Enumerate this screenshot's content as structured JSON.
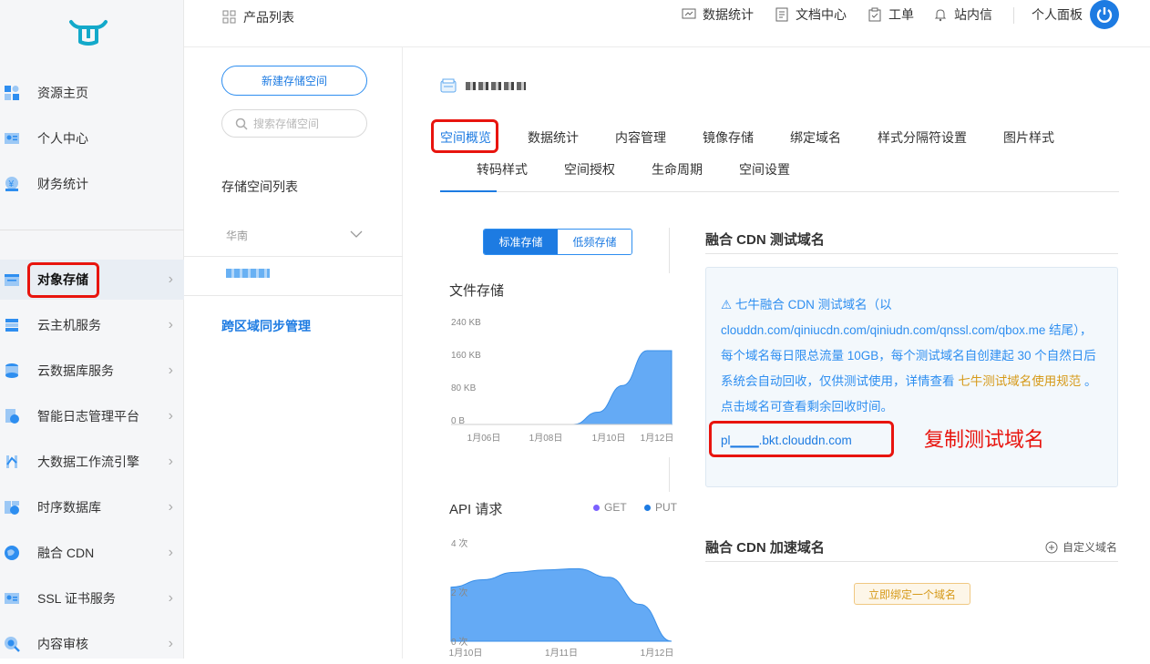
{
  "sidebar": {
    "items": [
      {
        "label": "资源主页",
        "icon": "resource-home-icon"
      },
      {
        "label": "个人中心",
        "icon": "personal-center-icon"
      },
      {
        "label": "财务统计",
        "icon": "finance-icon"
      },
      {
        "label": "对象存储",
        "icon": "object-storage-icon"
      },
      {
        "label": "云主机服务",
        "icon": "cloud-host-icon"
      },
      {
        "label": "云数据库服务",
        "icon": "cloud-database-icon"
      },
      {
        "label": "智能日志管理平台",
        "icon": "log-platform-icon"
      },
      {
        "label": "大数据工作流引擎",
        "icon": "workflow-engine-icon"
      },
      {
        "label": "时序数据库",
        "icon": "timeseries-db-icon"
      },
      {
        "label": "融合 CDN",
        "icon": "cdn-icon"
      },
      {
        "label": "SSL 证书服务",
        "icon": "ssl-icon"
      },
      {
        "label": "内容审核",
        "icon": "content-review-icon"
      }
    ]
  },
  "header": {
    "product_list": "产品列表",
    "data_stats": "数据统计",
    "docs": "文档中心",
    "tickets": "工单",
    "inbox": "站内信",
    "personal_panel": "个人面板"
  },
  "bucket_panel": {
    "new_button": "新建存储空间",
    "search_placeholder": "搜索存储空间",
    "list_title": "存储空间列表",
    "region": "华南",
    "cross_region": "跨区域同步管理"
  },
  "tabs": [
    "空间概览",
    "数据统计",
    "内容管理",
    "镜像存储",
    "绑定域名",
    "样式分隔符设置",
    "图片样式",
    "转码样式",
    "空间授权",
    "生命周期",
    "空间设置"
  ],
  "storage_toggle": {
    "standard": "标准存储",
    "low_freq": "低频存储"
  },
  "file_storage": {
    "title": "文件存储",
    "chart_data": {
      "type": "area",
      "x_ticks": [
        "1月06日",
        "1月08日",
        "1月10日",
        "1月12日"
      ],
      "y_ticks": [
        "240 KB",
        "160 KB",
        "80 KB",
        "0 B"
      ],
      "ylim": [
        0,
        240
      ],
      "x": [
        0,
        1,
        2,
        3,
        4,
        5,
        6,
        7,
        8
      ],
      "values": [
        0,
        0,
        0,
        0,
        0,
        0,
        30,
        95,
        180,
        180
      ]
    }
  },
  "api_requests": {
    "title": "API 请求",
    "legend": [
      "GET",
      "PUT"
    ],
    "chart_data": {
      "type": "area",
      "x_ticks": [
        "1月10日",
        "1月11日",
        "1月12日"
      ],
      "y_ticks": [
        "4 次",
        "2 次",
        "0 次"
      ],
      "ylim": [
        0,
        4
      ],
      "series": [
        {
          "name": "PUT",
          "values": [
            2.2,
            2.5,
            2.8,
            2.9,
            2.95,
            2.6,
            1.5,
            0
          ]
        }
      ]
    }
  },
  "cdn_test": {
    "title": "融合 CDN 测试域名",
    "notice": "⚠ 七牛融合 CDN 测试域名（以 clouddn.com/qiniucdn.com/qiniudn.com/qnssl.com/qbox.me 结尾），每个域名每日限总流量 10GB，每个测试域名自创建起 30 个自然日后系统会自动回收，仅供测试使用，详情查看 ",
    "notice_link": "七牛测试域名使用规范",
    "notice_tail": " 。点击域名可查看剩余回收时间。",
    "domain": "pl▁▁▁.bkt.clouddn.com",
    "annotation": "复制测试域名"
  },
  "cdn_accel": {
    "title": "融合 CDN 加速域名",
    "custom": "自定义域名",
    "bind_button": "立即绑定一个域名"
  },
  "colors": {
    "accent": "#1d7be2",
    "highlight": "#e8140e",
    "area": "#64aaf5",
    "get_dot": "#7b61ff"
  }
}
